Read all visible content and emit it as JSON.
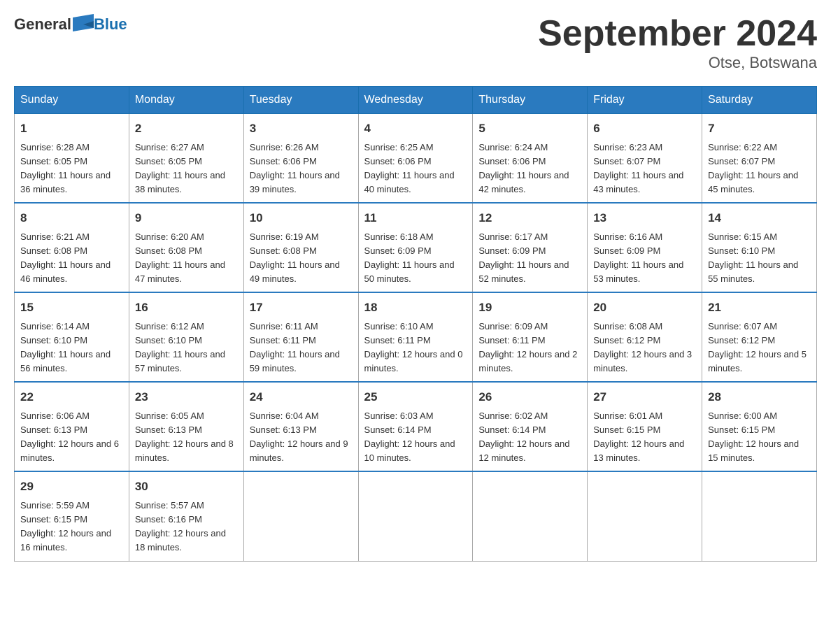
{
  "header": {
    "logo_general": "General",
    "logo_blue": "Blue",
    "month_title": "September 2024",
    "location": "Otse, Botswana"
  },
  "days_of_week": [
    "Sunday",
    "Monday",
    "Tuesday",
    "Wednesday",
    "Thursday",
    "Friday",
    "Saturday"
  ],
  "weeks": [
    [
      {
        "day": "1",
        "sunrise": "6:28 AM",
        "sunset": "6:05 PM",
        "daylight": "11 hours and 36 minutes."
      },
      {
        "day": "2",
        "sunrise": "6:27 AM",
        "sunset": "6:05 PM",
        "daylight": "11 hours and 38 minutes."
      },
      {
        "day": "3",
        "sunrise": "6:26 AM",
        "sunset": "6:06 PM",
        "daylight": "11 hours and 39 minutes."
      },
      {
        "day": "4",
        "sunrise": "6:25 AM",
        "sunset": "6:06 PM",
        "daylight": "11 hours and 40 minutes."
      },
      {
        "day": "5",
        "sunrise": "6:24 AM",
        "sunset": "6:06 PM",
        "daylight": "11 hours and 42 minutes."
      },
      {
        "day": "6",
        "sunrise": "6:23 AM",
        "sunset": "6:07 PM",
        "daylight": "11 hours and 43 minutes."
      },
      {
        "day": "7",
        "sunrise": "6:22 AM",
        "sunset": "6:07 PM",
        "daylight": "11 hours and 45 minutes."
      }
    ],
    [
      {
        "day": "8",
        "sunrise": "6:21 AM",
        "sunset": "6:08 PM",
        "daylight": "11 hours and 46 minutes."
      },
      {
        "day": "9",
        "sunrise": "6:20 AM",
        "sunset": "6:08 PM",
        "daylight": "11 hours and 47 minutes."
      },
      {
        "day": "10",
        "sunrise": "6:19 AM",
        "sunset": "6:08 PM",
        "daylight": "11 hours and 49 minutes."
      },
      {
        "day": "11",
        "sunrise": "6:18 AM",
        "sunset": "6:09 PM",
        "daylight": "11 hours and 50 minutes."
      },
      {
        "day": "12",
        "sunrise": "6:17 AM",
        "sunset": "6:09 PM",
        "daylight": "11 hours and 52 minutes."
      },
      {
        "day": "13",
        "sunrise": "6:16 AM",
        "sunset": "6:09 PM",
        "daylight": "11 hours and 53 minutes."
      },
      {
        "day": "14",
        "sunrise": "6:15 AM",
        "sunset": "6:10 PM",
        "daylight": "11 hours and 55 minutes."
      }
    ],
    [
      {
        "day": "15",
        "sunrise": "6:14 AM",
        "sunset": "6:10 PM",
        "daylight": "11 hours and 56 minutes."
      },
      {
        "day": "16",
        "sunrise": "6:12 AM",
        "sunset": "6:10 PM",
        "daylight": "11 hours and 57 minutes."
      },
      {
        "day": "17",
        "sunrise": "6:11 AM",
        "sunset": "6:11 PM",
        "daylight": "11 hours and 59 minutes."
      },
      {
        "day": "18",
        "sunrise": "6:10 AM",
        "sunset": "6:11 PM",
        "daylight": "12 hours and 0 minutes."
      },
      {
        "day": "19",
        "sunrise": "6:09 AM",
        "sunset": "6:11 PM",
        "daylight": "12 hours and 2 minutes."
      },
      {
        "day": "20",
        "sunrise": "6:08 AM",
        "sunset": "6:12 PM",
        "daylight": "12 hours and 3 minutes."
      },
      {
        "day": "21",
        "sunrise": "6:07 AM",
        "sunset": "6:12 PM",
        "daylight": "12 hours and 5 minutes."
      }
    ],
    [
      {
        "day": "22",
        "sunrise": "6:06 AM",
        "sunset": "6:13 PM",
        "daylight": "12 hours and 6 minutes."
      },
      {
        "day": "23",
        "sunrise": "6:05 AM",
        "sunset": "6:13 PM",
        "daylight": "12 hours and 8 minutes."
      },
      {
        "day": "24",
        "sunrise": "6:04 AM",
        "sunset": "6:13 PM",
        "daylight": "12 hours and 9 minutes."
      },
      {
        "day": "25",
        "sunrise": "6:03 AM",
        "sunset": "6:14 PM",
        "daylight": "12 hours and 10 minutes."
      },
      {
        "day": "26",
        "sunrise": "6:02 AM",
        "sunset": "6:14 PM",
        "daylight": "12 hours and 12 minutes."
      },
      {
        "day": "27",
        "sunrise": "6:01 AM",
        "sunset": "6:15 PM",
        "daylight": "12 hours and 13 minutes."
      },
      {
        "day": "28",
        "sunrise": "6:00 AM",
        "sunset": "6:15 PM",
        "daylight": "12 hours and 15 minutes."
      }
    ],
    [
      {
        "day": "29",
        "sunrise": "5:59 AM",
        "sunset": "6:15 PM",
        "daylight": "12 hours and 16 minutes."
      },
      {
        "day": "30",
        "sunrise": "5:57 AM",
        "sunset": "6:16 PM",
        "daylight": "12 hours and 18 minutes."
      },
      {
        "day": "",
        "sunrise": "",
        "sunset": "",
        "daylight": ""
      },
      {
        "day": "",
        "sunrise": "",
        "sunset": "",
        "daylight": ""
      },
      {
        "day": "",
        "sunrise": "",
        "sunset": "",
        "daylight": ""
      },
      {
        "day": "",
        "sunrise": "",
        "sunset": "",
        "daylight": ""
      },
      {
        "day": "",
        "sunrise": "",
        "sunset": "",
        "daylight": ""
      }
    ]
  ],
  "labels": {
    "sunrise_prefix": "Sunrise: ",
    "sunset_prefix": "Sunset: ",
    "daylight_prefix": "Daylight: "
  }
}
